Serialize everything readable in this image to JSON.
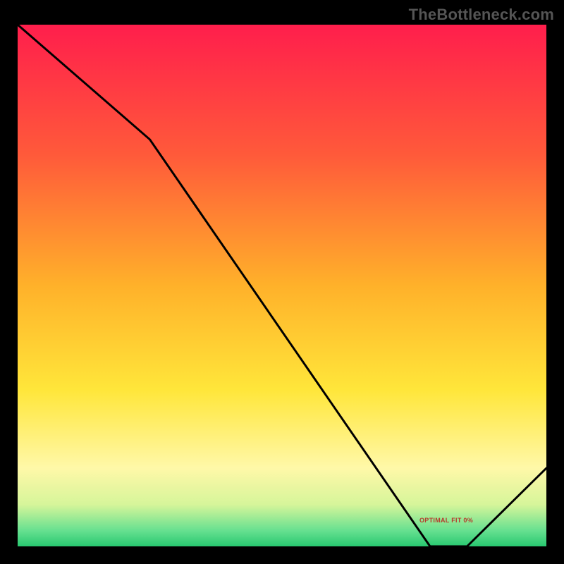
{
  "watermark": "TheBottleneck.com",
  "curve_label": {
    "text": "OPTIMAL FIT 0%",
    "left_pct": 76,
    "top_pct": 94.3
  },
  "chart_data": {
    "type": "line",
    "title": "",
    "xlabel": "",
    "ylabel": "",
    "xlim": [
      0,
      100
    ],
    "ylim": [
      0,
      100
    ],
    "series": [
      {
        "name": "bottleneck-curve",
        "x": [
          0,
          25,
          78,
          85,
          100
        ],
        "y": [
          100,
          78,
          0,
          0,
          15
        ]
      }
    ],
    "gradient_stops": [
      {
        "offset": 0.0,
        "color": "#ff1e4c"
      },
      {
        "offset": 0.25,
        "color": "#ff5a3a"
      },
      {
        "offset": 0.5,
        "color": "#ffb12a"
      },
      {
        "offset": 0.7,
        "color": "#ffe63a"
      },
      {
        "offset": 0.85,
        "color": "#fff8a8"
      },
      {
        "offset": 0.92,
        "color": "#d6f59a"
      },
      {
        "offset": 0.97,
        "color": "#66e090"
      },
      {
        "offset": 1.0,
        "color": "#28c870"
      }
    ],
    "annotations": [
      {
        "text": "OPTIMAL FIT 0%",
        "x": 82,
        "y": 1
      }
    ]
  }
}
